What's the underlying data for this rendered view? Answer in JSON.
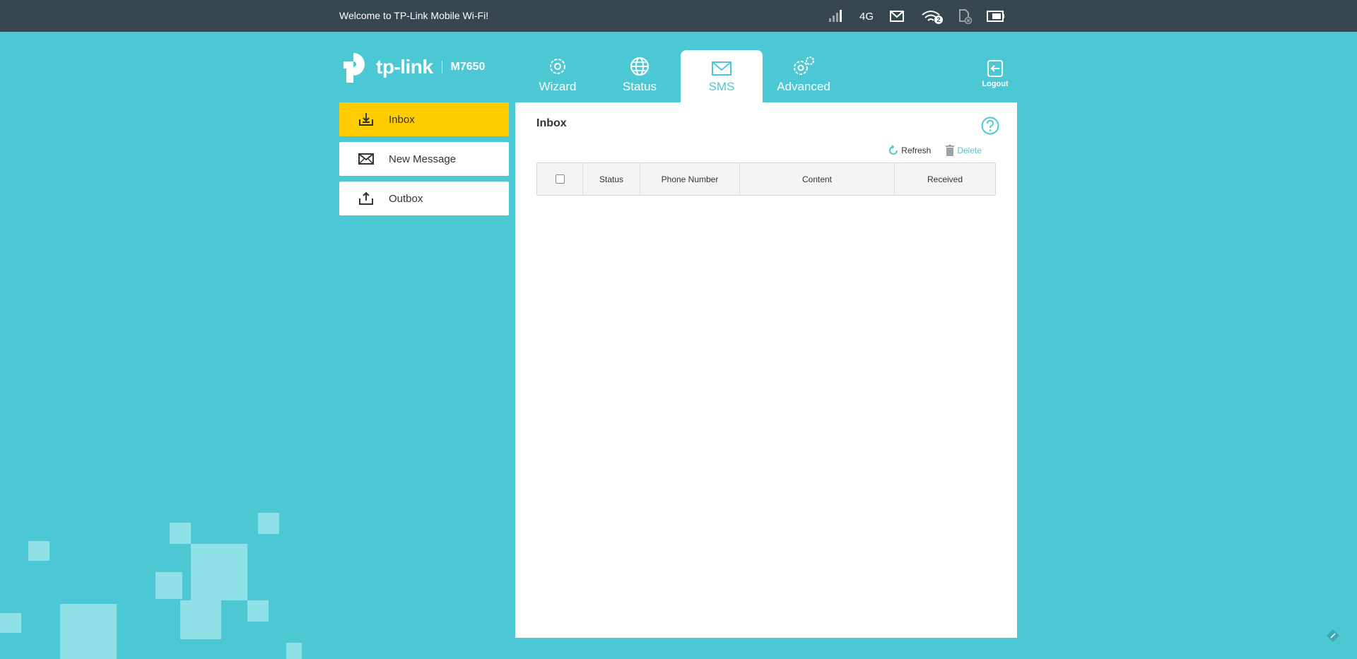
{
  "topbar": {
    "welcome": "Welcome to TP-Link Mobile Wi-Fi!",
    "network_type": "4G",
    "wifi_clients": "2",
    "icons": [
      "signal-icon",
      "mail-icon",
      "wifi-icon",
      "sim-card-icon",
      "battery-icon"
    ]
  },
  "header": {
    "logo_text": "tp-link",
    "model": "M7650",
    "logout_label": "Logout"
  },
  "nav": {
    "wizard": "Wizard",
    "status": "Status",
    "sms": "SMS",
    "advanced": "Advanced",
    "active": "SMS"
  },
  "sidebar": {
    "items": [
      {
        "label": "Inbox",
        "icon": "inbox-icon",
        "active": true
      },
      {
        "label": "New Message",
        "icon": "envelope-icon",
        "active": false
      },
      {
        "label": "Outbox",
        "icon": "outbox-icon",
        "active": false
      }
    ]
  },
  "main": {
    "title": "Inbox",
    "refresh_label": "Refresh",
    "delete_label": "Delete",
    "table": {
      "columns": [
        "Status",
        "Phone Number",
        "Content",
        "Received"
      ],
      "rows": []
    }
  },
  "colors": {
    "background": "#4bc8d4",
    "topbar": "#37474f",
    "active_sidebar": "#ffcc00",
    "accent": "#4bc8d4"
  }
}
